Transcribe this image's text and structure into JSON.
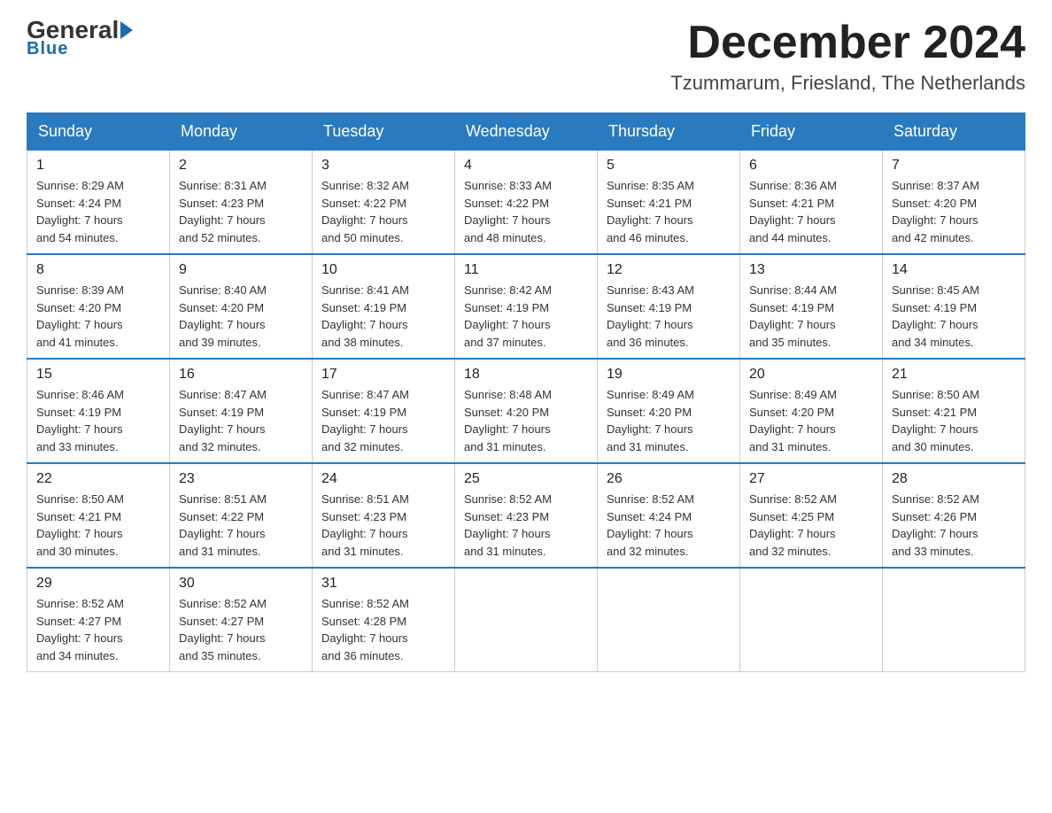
{
  "logo": {
    "general": "General",
    "blue": "Blue"
  },
  "title": "December 2024",
  "location": "Tzummarum, Friesland, The Netherlands",
  "days_header": [
    "Sunday",
    "Monday",
    "Tuesday",
    "Wednesday",
    "Thursday",
    "Friday",
    "Saturday"
  ],
  "weeks": [
    [
      {
        "day": "1",
        "sunrise": "8:29 AM",
        "sunset": "4:24 PM",
        "daylight": "7 hours and 54 minutes."
      },
      {
        "day": "2",
        "sunrise": "8:31 AM",
        "sunset": "4:23 PM",
        "daylight": "7 hours and 52 minutes."
      },
      {
        "day": "3",
        "sunrise": "8:32 AM",
        "sunset": "4:22 PM",
        "daylight": "7 hours and 50 minutes."
      },
      {
        "day": "4",
        "sunrise": "8:33 AM",
        "sunset": "4:22 PM",
        "daylight": "7 hours and 48 minutes."
      },
      {
        "day": "5",
        "sunrise": "8:35 AM",
        "sunset": "4:21 PM",
        "daylight": "7 hours and 46 minutes."
      },
      {
        "day": "6",
        "sunrise": "8:36 AM",
        "sunset": "4:21 PM",
        "daylight": "7 hours and 44 minutes."
      },
      {
        "day": "7",
        "sunrise": "8:37 AM",
        "sunset": "4:20 PM",
        "daylight": "7 hours and 42 minutes."
      }
    ],
    [
      {
        "day": "8",
        "sunrise": "8:39 AM",
        "sunset": "4:20 PM",
        "daylight": "7 hours and 41 minutes."
      },
      {
        "day": "9",
        "sunrise": "8:40 AM",
        "sunset": "4:20 PM",
        "daylight": "7 hours and 39 minutes."
      },
      {
        "day": "10",
        "sunrise": "8:41 AM",
        "sunset": "4:19 PM",
        "daylight": "7 hours and 38 minutes."
      },
      {
        "day": "11",
        "sunrise": "8:42 AM",
        "sunset": "4:19 PM",
        "daylight": "7 hours and 37 minutes."
      },
      {
        "day": "12",
        "sunrise": "8:43 AM",
        "sunset": "4:19 PM",
        "daylight": "7 hours and 36 minutes."
      },
      {
        "day": "13",
        "sunrise": "8:44 AM",
        "sunset": "4:19 PM",
        "daylight": "7 hours and 35 minutes."
      },
      {
        "day": "14",
        "sunrise": "8:45 AM",
        "sunset": "4:19 PM",
        "daylight": "7 hours and 34 minutes."
      }
    ],
    [
      {
        "day": "15",
        "sunrise": "8:46 AM",
        "sunset": "4:19 PM",
        "daylight": "7 hours and 33 minutes."
      },
      {
        "day": "16",
        "sunrise": "8:47 AM",
        "sunset": "4:19 PM",
        "daylight": "7 hours and 32 minutes."
      },
      {
        "day": "17",
        "sunrise": "8:47 AM",
        "sunset": "4:19 PM",
        "daylight": "7 hours and 32 minutes."
      },
      {
        "day": "18",
        "sunrise": "8:48 AM",
        "sunset": "4:20 PM",
        "daylight": "7 hours and 31 minutes."
      },
      {
        "day": "19",
        "sunrise": "8:49 AM",
        "sunset": "4:20 PM",
        "daylight": "7 hours and 31 minutes."
      },
      {
        "day": "20",
        "sunrise": "8:49 AM",
        "sunset": "4:20 PM",
        "daylight": "7 hours and 31 minutes."
      },
      {
        "day": "21",
        "sunrise": "8:50 AM",
        "sunset": "4:21 PM",
        "daylight": "7 hours and 30 minutes."
      }
    ],
    [
      {
        "day": "22",
        "sunrise": "8:50 AM",
        "sunset": "4:21 PM",
        "daylight": "7 hours and 30 minutes."
      },
      {
        "day": "23",
        "sunrise": "8:51 AM",
        "sunset": "4:22 PM",
        "daylight": "7 hours and 31 minutes."
      },
      {
        "day": "24",
        "sunrise": "8:51 AM",
        "sunset": "4:23 PM",
        "daylight": "7 hours and 31 minutes."
      },
      {
        "day": "25",
        "sunrise": "8:52 AM",
        "sunset": "4:23 PM",
        "daylight": "7 hours and 31 minutes."
      },
      {
        "day": "26",
        "sunrise": "8:52 AM",
        "sunset": "4:24 PM",
        "daylight": "7 hours and 32 minutes."
      },
      {
        "day": "27",
        "sunrise": "8:52 AM",
        "sunset": "4:25 PM",
        "daylight": "7 hours and 32 minutes."
      },
      {
        "day": "28",
        "sunrise": "8:52 AM",
        "sunset": "4:26 PM",
        "daylight": "7 hours and 33 minutes."
      }
    ],
    [
      {
        "day": "29",
        "sunrise": "8:52 AM",
        "sunset": "4:27 PM",
        "daylight": "7 hours and 34 minutes."
      },
      {
        "day": "30",
        "sunrise": "8:52 AM",
        "sunset": "4:27 PM",
        "daylight": "7 hours and 35 minutes."
      },
      {
        "day": "31",
        "sunrise": "8:52 AM",
        "sunset": "4:28 PM",
        "daylight": "7 hours and 36 minutes."
      },
      null,
      null,
      null,
      null
    ]
  ],
  "labels": {
    "sunrise": "Sunrise:",
    "sunset": "Sunset:",
    "daylight": "Daylight:"
  }
}
